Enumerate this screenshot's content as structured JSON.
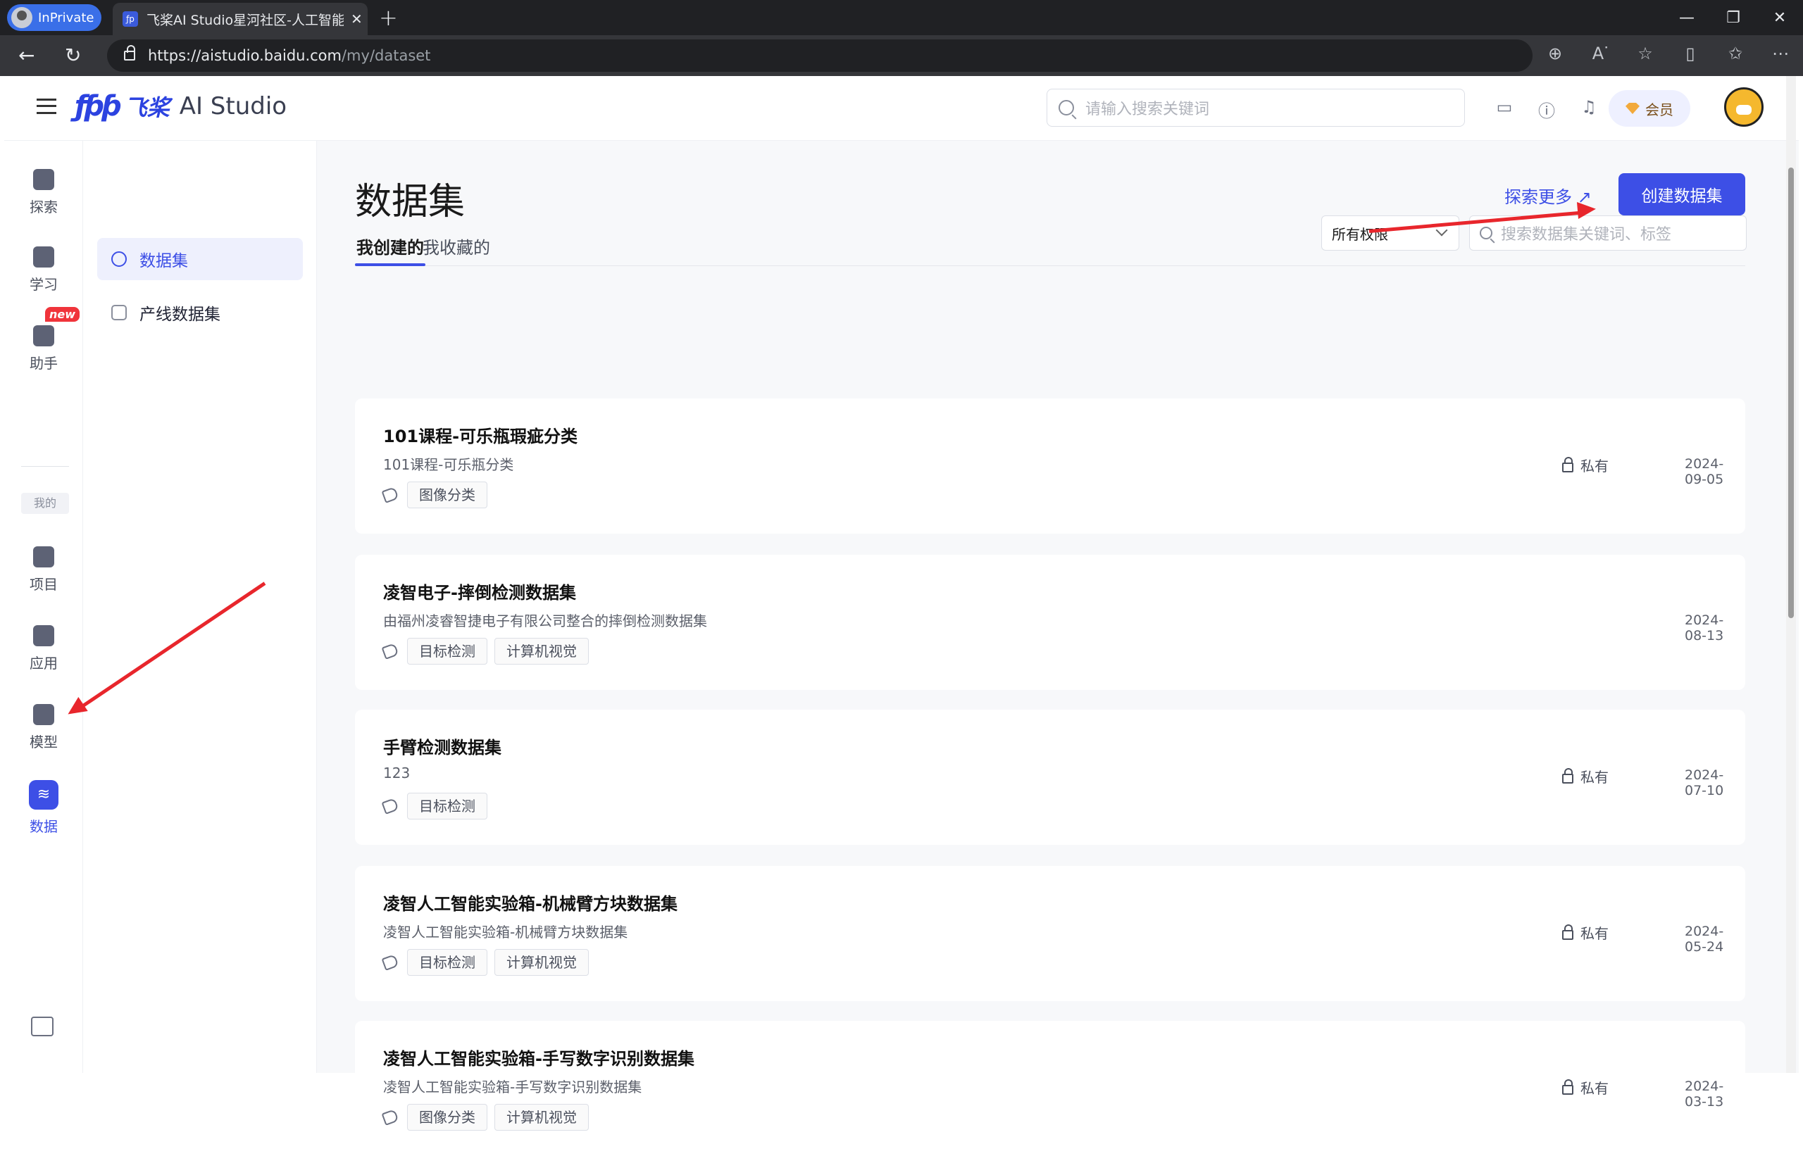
{
  "browser": {
    "inprivate_label": "InPrivate",
    "tab_title": "飞桨AI Studio星河社区-人工智能",
    "new_tab": "+",
    "window_controls": [
      "—",
      "❐",
      "✕"
    ],
    "url_domain": "https://aistudio.baidu.com",
    "url_path": "/my/dataset"
  },
  "header": {
    "logo_mark": "ƒƥƥ",
    "logo_cn": "飞桨",
    "logo_en": "AI Studio",
    "search_placeholder": "请输入搜索关键词",
    "vip_label": "会员"
  },
  "rail": {
    "items": [
      {
        "label": "探索",
        "icon": "compass-icon"
      },
      {
        "label": "学习",
        "icon": "book-icon"
      },
      {
        "label": "助手",
        "icon": "chat-icon"
      },
      {
        "label": "项目",
        "icon": "code-folder-icon"
      },
      {
        "label": "应用",
        "icon": "apps-grid-icon"
      },
      {
        "label": "模型",
        "icon": "cube-icon"
      },
      {
        "label": "数据",
        "icon": "database-icon"
      }
    ],
    "new_badge": "new",
    "mine_label": "我的"
  },
  "subnav": {
    "items": [
      {
        "label": "数据集",
        "active": true
      },
      {
        "label": "产线数据集",
        "active": false
      }
    ]
  },
  "main": {
    "title": "数据集",
    "explore_more": "探索更多 ↗",
    "create_button": "创建数据集",
    "tabs": [
      "我创建的",
      "我收藏的"
    ],
    "permission_select": "所有权限",
    "dataset_search_placeholder": "搜索数据集关键词、标签",
    "datasets": [
      {
        "name": "101课程-可乐瓶瑕疵分类",
        "desc": "101课程-可乐瓶分类",
        "tags": [
          "图像分类"
        ],
        "privacy": "私有",
        "date": "2024-09-05"
      },
      {
        "name": "凌智电子-摔倒检测数据集",
        "desc": "由福州凌睿智捷电子有限公司整合的摔倒检测数据集",
        "tags": [
          "目标检测",
          "计算机视觉"
        ],
        "privacy": "",
        "date": "2024-08-13"
      },
      {
        "name": "手臂检测数据集",
        "desc": "123",
        "tags": [
          "目标检测"
        ],
        "privacy": "私有",
        "date": "2024-07-10"
      },
      {
        "name": "凌智人工智能实验箱-机械臂方块数据集",
        "desc": "凌智人工智能实验箱-机械臂方块数据集",
        "tags": [
          "目标检测",
          "计算机视觉"
        ],
        "privacy": "私有",
        "date": "2024-05-24"
      },
      {
        "name": "凌智人工智能实验箱-手写数字识别数据集",
        "desc": "凌智人工智能实验箱-手写数字识别数据集",
        "tags": [
          "图像分类",
          "计算机视觉"
        ],
        "privacy": "私有",
        "date": "2024-03-13"
      }
    ]
  },
  "colors": {
    "accent": "#3d4fe6",
    "annotation_arrow": "#e8262c"
  }
}
